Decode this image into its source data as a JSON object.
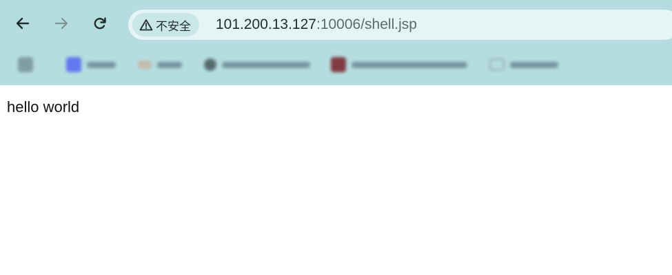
{
  "toolbar": {
    "back_icon": "back-arrow-icon",
    "forward_icon": "forward-arrow-icon",
    "reload_icon": "reload-icon",
    "security_label": "不安全",
    "security_icon": "warning-triangle-icon",
    "url_host": "101.200.13.127",
    "url_rest": ":10006/shell.jsp"
  },
  "page": {
    "body_text": "hello world"
  },
  "colors": {
    "chrome_background": "#b5dde0",
    "omnibox_background": "#e6f4f5",
    "page_background": "#ffffff"
  }
}
